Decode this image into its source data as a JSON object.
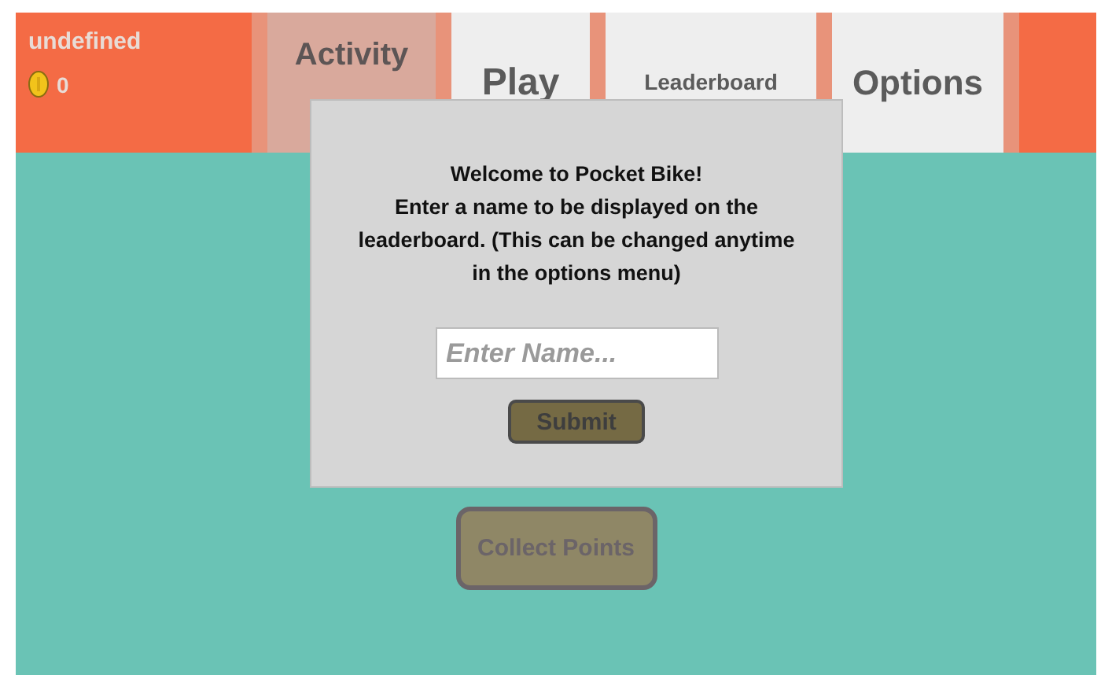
{
  "player": {
    "name": "undefined",
    "coins": "0"
  },
  "tabs": [
    {
      "label": "Activity",
      "selected": true
    },
    {
      "label": "Play",
      "selected": false
    },
    {
      "label": "Leaderboard",
      "selected": false
    },
    {
      "label": "Options",
      "selected": false
    }
  ],
  "dialog": {
    "message": "Welcome to Pocket Bike!\nEnter a name to be displayed on the leaderboard. (This can be changed anytime in the options menu)",
    "name_field": {
      "placeholder": "Enter Name..."
    },
    "submit": "Submit"
  },
  "collect_button": "Collect Points"
}
